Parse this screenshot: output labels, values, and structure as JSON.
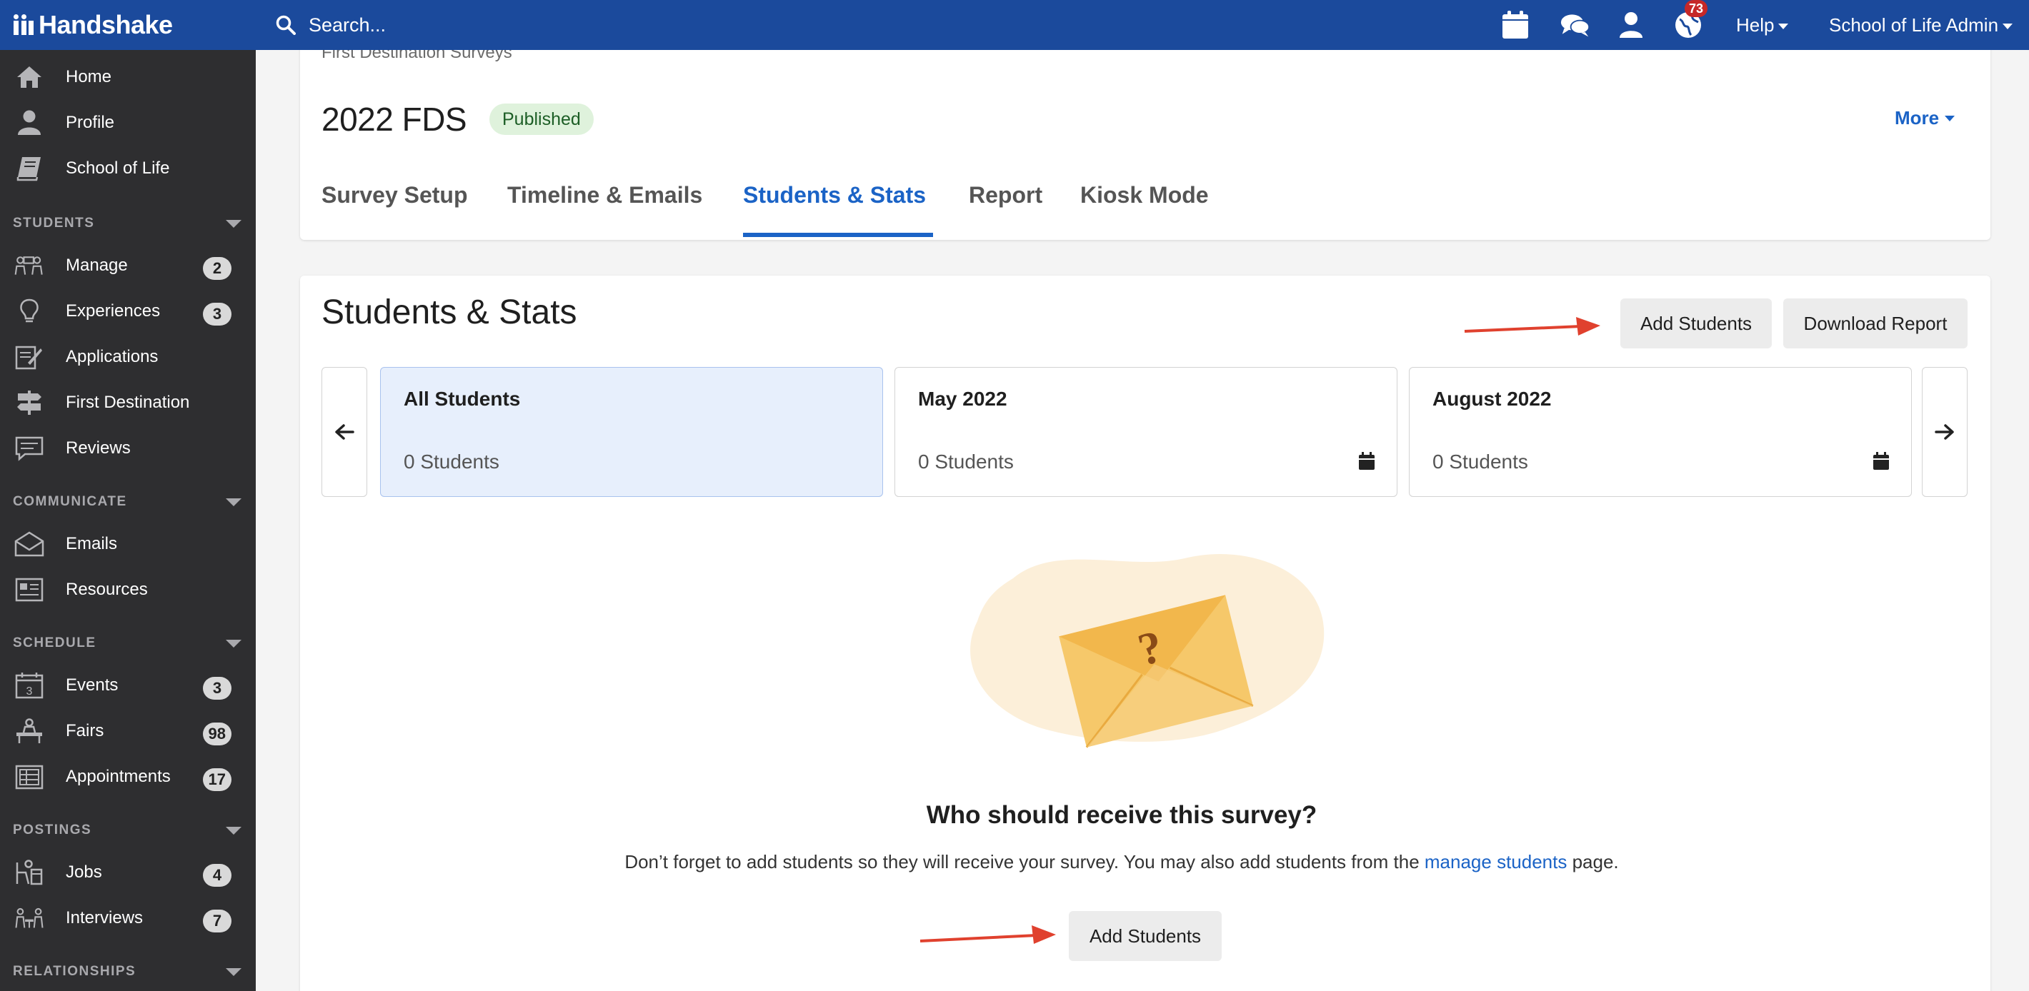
{
  "app": {
    "brand": "Handshake"
  },
  "topbar": {
    "search_placeholder": "Search...",
    "notifications_count": "73",
    "help_label": "Help",
    "user_label": "School of Life Admin"
  },
  "sidebar": {
    "top_items": [
      {
        "label": "Home",
        "icon": "home-icon"
      },
      {
        "label": "Profile",
        "icon": "profile-icon"
      },
      {
        "label": "School of Life",
        "icon": "book-icon"
      }
    ],
    "sections": [
      {
        "title": "STUDENTS",
        "items": [
          {
            "label": "Manage",
            "badge": "2"
          },
          {
            "label": "Experiences",
            "badge": "3"
          },
          {
            "label": "Applications",
            "badge": ""
          },
          {
            "label": "First Destination",
            "badge": ""
          },
          {
            "label": "Reviews",
            "badge": ""
          }
        ]
      },
      {
        "title": "COMMUNICATE",
        "items": [
          {
            "label": "Emails",
            "badge": ""
          },
          {
            "label": "Resources",
            "badge": ""
          }
        ]
      },
      {
        "title": "SCHEDULE",
        "items": [
          {
            "label": "Events",
            "badge": "3"
          },
          {
            "label": "Fairs",
            "badge": "98"
          },
          {
            "label": "Appointments",
            "badge": "17"
          }
        ]
      },
      {
        "title": "POSTINGS",
        "items": [
          {
            "label": "Jobs",
            "badge": "4"
          },
          {
            "label": "Interviews",
            "badge": "7"
          }
        ]
      },
      {
        "title": "RELATIONSHIPS",
        "items": []
      }
    ]
  },
  "header": {
    "breadcrumb": "First Destination Surveys",
    "title": "2022 FDS",
    "status_badge": "Published",
    "more_label": "More",
    "tabs": [
      "Survey Setup",
      "Timeline & Emails",
      "Students & Stats",
      "Report",
      "Kiosk Mode"
    ],
    "active_tab": "Students & Stats"
  },
  "stats": {
    "title": "Students & Stats",
    "add_students_label": "Add Students",
    "download_report_label": "Download Report",
    "periods": [
      {
        "title": "All Students",
        "count": "0 Students"
      },
      {
        "title": "May 2022",
        "count": "0 Students"
      },
      {
        "title": "August 2022",
        "count": "0 Students"
      }
    ],
    "empty_question": "Who should receive this survey?",
    "empty_desc_before": "Don’t forget to add students so they will receive your survey. You may also add students from the",
    "empty_link": "manage students",
    "empty_desc_after": "page.",
    "empty_button_label": "Add Students"
  },
  "colors": {
    "topbar": "#1b4a9c",
    "sidebar": "#2e2e30",
    "accent": "#1b63c6",
    "annotation_arrow": "#e0412e"
  }
}
